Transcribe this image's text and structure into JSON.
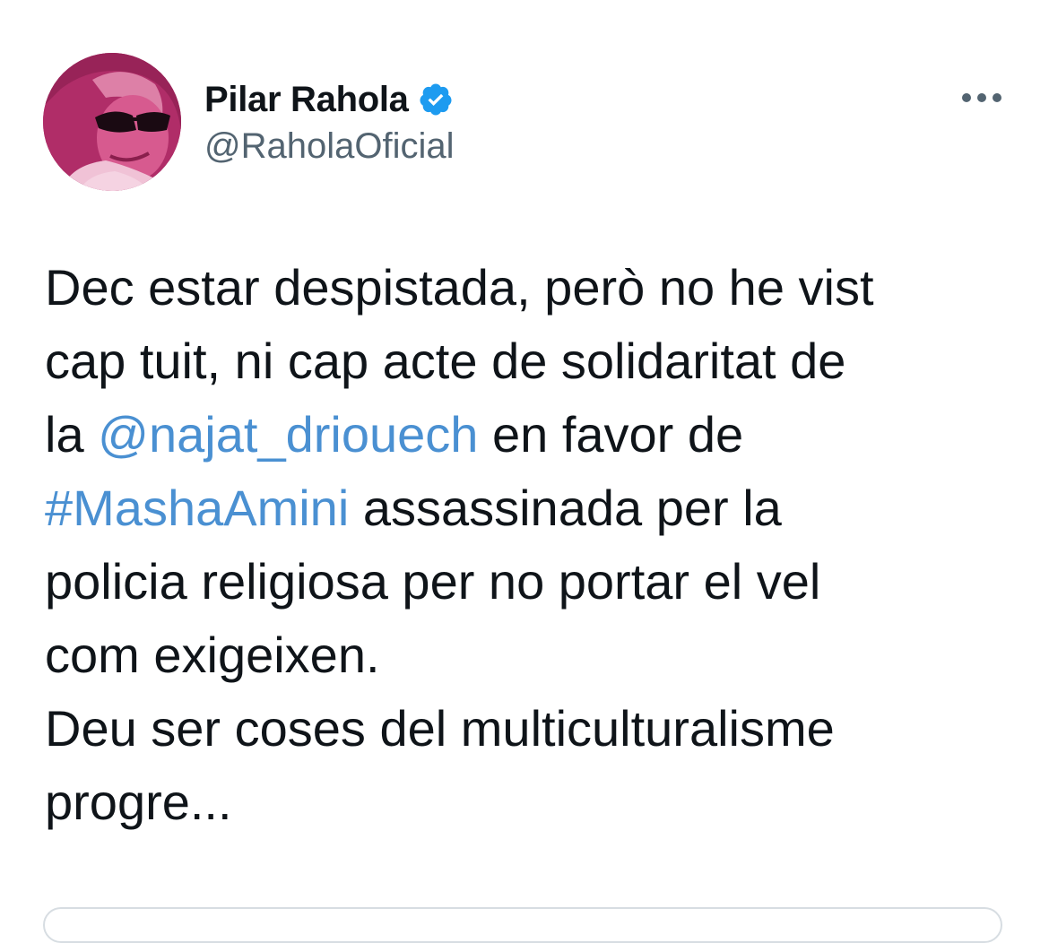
{
  "author": {
    "display_name": "Pilar Rahola",
    "handle": "@RaholaOficial",
    "verified": true,
    "avatar_icon": "profile-photo",
    "verified_icon": "verified-badge-icon",
    "verified_color": "#1d9bf0"
  },
  "menu": {
    "icon": "more-options-icon"
  },
  "tweet": {
    "lines": [
      {
        "parts": [
          {
            "text": "Dec estar despistada, però no he vist"
          }
        ]
      },
      {
        "parts": [
          {
            "text": "cap tuit, ni cap acte de solidaritat de"
          }
        ]
      },
      {
        "parts": [
          {
            "text": "la "
          },
          {
            "text": "@najat_driouech",
            "link": true
          },
          {
            "text": " en favor de"
          }
        ]
      },
      {
        "parts": [
          {
            "text": "#MashaAmini",
            "link": true
          },
          {
            "text": " assassinada per la"
          }
        ]
      },
      {
        "parts": [
          {
            "text": "policia religiosa per no portar el vel"
          }
        ]
      },
      {
        "parts": [
          {
            "text": "com exigeixen."
          }
        ]
      },
      {
        "parts": [
          {
            "text": "Deu ser coses del multiculturalisme"
          }
        ]
      },
      {
        "parts": [
          {
            "text": "progre..."
          }
        ]
      }
    ],
    "link_color": "#4a90d2",
    "text_color": "#0f1419"
  }
}
